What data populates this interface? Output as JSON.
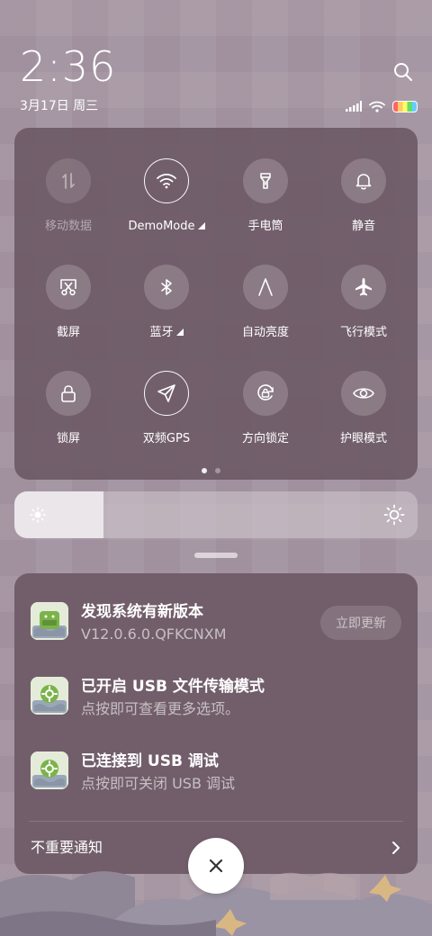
{
  "status": {
    "time": "2:36",
    "date": "3月17日 周三"
  },
  "control_center": {
    "toggles": [
      {
        "label": "移动数据",
        "icon": "mobile-data-icon",
        "state": "disabled"
      },
      {
        "label": "DemoMode",
        "icon": "wifi-icon",
        "state": "on",
        "has_menu": true
      },
      {
        "label": "手电筒",
        "icon": "flashlight-icon",
        "state": "off"
      },
      {
        "label": "静音",
        "icon": "bell-icon",
        "state": "off"
      },
      {
        "label": "截屏",
        "icon": "scissors-icon",
        "state": "off"
      },
      {
        "label": "蓝牙",
        "icon": "bluetooth-icon",
        "state": "off",
        "has_menu": true
      },
      {
        "label": "自动亮度",
        "icon": "auto-brightness-icon",
        "state": "off"
      },
      {
        "label": "飞行模式",
        "icon": "airplane-icon",
        "state": "off"
      },
      {
        "label": "锁屏",
        "icon": "lock-icon",
        "state": "off"
      },
      {
        "label": "双频GPS",
        "icon": "gps-icon",
        "state": "on"
      },
      {
        "label": "方向锁定",
        "icon": "rotation-lock-icon",
        "state": "off"
      },
      {
        "label": "护眼模式",
        "icon": "eye-icon",
        "state": "off"
      }
    ],
    "page_count": 2,
    "active_page": 1
  },
  "brightness": {
    "level": 0.22
  },
  "notifications": [
    {
      "title": "发现系统有新版本",
      "body": "V12.0.6.0.QFKCNXM",
      "action": "立即更新"
    },
    {
      "title": "已开启 USB 文件传输模式",
      "body": "点按即可查看更多选项。"
    },
    {
      "title": "已连接到 USB 调试",
      "body": "点按即可关闭 USB 调试"
    }
  ],
  "footer": {
    "unimportant_label": "不重要通知"
  },
  "colors": {
    "background": "#a1919e",
    "panel": "#6e5a67",
    "accent_white": "#ffffff"
  }
}
